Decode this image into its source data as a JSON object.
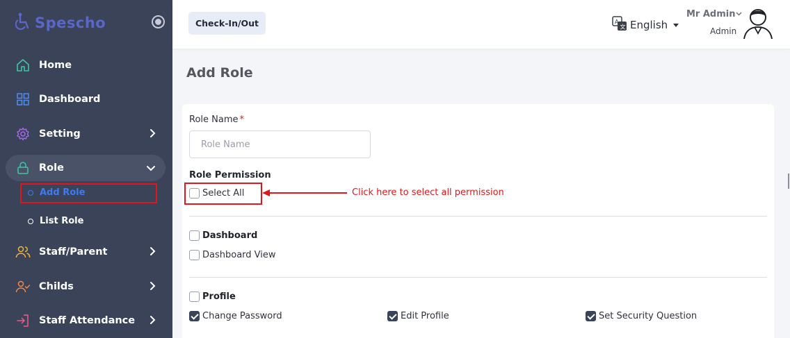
{
  "brand": {
    "name": "Spescho"
  },
  "sidebar": {
    "items": [
      {
        "label": "Home"
      },
      {
        "label": "Dashboard"
      },
      {
        "label": "Setting"
      },
      {
        "label": "Role"
      },
      {
        "label": "Staff/Parent"
      },
      {
        "label": "Childs"
      },
      {
        "label": "Staff Attendance"
      }
    ],
    "role_subitems": [
      {
        "label": "Add Role"
      },
      {
        "label": "List Role"
      }
    ]
  },
  "header": {
    "checkin_label": "Check-In/Out",
    "language": "English",
    "user_name": "Mr Admin",
    "user_role": "Admin"
  },
  "page": {
    "title": "Add Role",
    "role_name_label": "Role Name",
    "required_mark": "*",
    "role_name_placeholder": "Role Name",
    "role_name_value": "",
    "permission_title": "Role Permission",
    "select_all_label": "Select All",
    "annotation": "Click here to select all permission"
  },
  "permissions": {
    "dashboard": {
      "title": "Dashboard",
      "checked": false,
      "items": [
        {
          "label": "Dashboard View",
          "checked": false
        }
      ]
    },
    "profile": {
      "title": "Profile",
      "checked": false,
      "items": [
        {
          "label": "Change Password",
          "checked": true
        },
        {
          "label": "Edit Profile",
          "checked": true
        },
        {
          "label": "Set Security Question",
          "checked": true
        }
      ]
    }
  },
  "colors": {
    "sidebar_bg": "#3b4359",
    "accent_blue": "#3e7bf0",
    "annotation_red": "#e0161a",
    "icon_green": "#3fc7a3",
    "icon_blue": "#4f8cf0",
    "icon_purple": "#a46bf0",
    "icon_yellow": "#f2b53a",
    "icon_orange": "#f08a4b",
    "icon_pink": "#f05c8a"
  },
  "icons": [
    "wheelchair-icon",
    "radio-toggle-icon",
    "home-icon",
    "grid-icon",
    "gear-icon",
    "lock-icon",
    "users-icon",
    "user-check-icon",
    "login-icon",
    "chevron-right-icon",
    "chevron-down-icon",
    "translate-icon",
    "caret-down-icon",
    "avatar-icon",
    "arrow-left-icon"
  ]
}
